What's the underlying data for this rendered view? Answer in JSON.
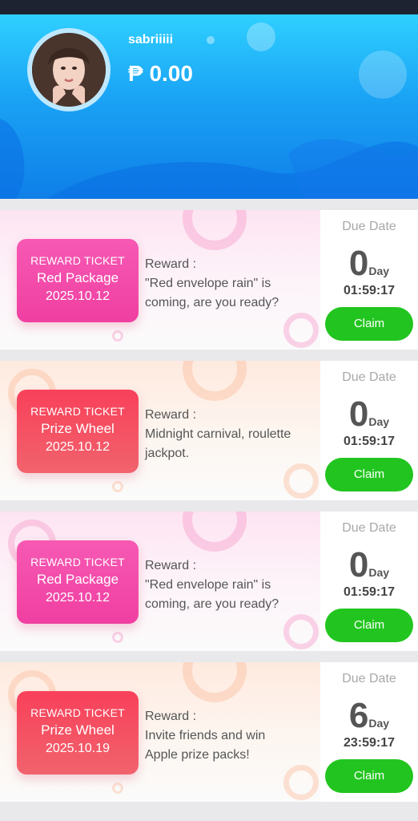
{
  "profile": {
    "username": "sabriiiii",
    "balance": "₱ 0.00"
  },
  "tickets": [
    {
      "type": "REWARD TICKET",
      "name": "Red Package",
      "date": "2025.10.12",
      "reward_label": "Reward :",
      "reward_text": "\"Red envelope rain\" is coming, are you ready?",
      "due_label": "Due Date",
      "days": "0",
      "days_unit": "Day",
      "time": "01:59:17",
      "claim_label": "Claim"
    },
    {
      "type": "REWARD TICKET",
      "name": "Prize Wheel",
      "date": "2025.10.12",
      "reward_label": "Reward :",
      "reward_text": "Midnight carnival, roulette jackpot.",
      "due_label": "Due Date",
      "days": "0",
      "days_unit": "Day",
      "time": "01:59:17",
      "claim_label": "Claim"
    },
    {
      "type": "REWARD TICKET",
      "name": "Red Package",
      "date": "2025.10.12",
      "reward_label": "Reward :",
      "reward_text": "\"Red envelope rain\" is coming, are you ready?",
      "due_label": "Due Date",
      "days": "0",
      "days_unit": "Day",
      "time": "01:59:17",
      "claim_label": "Claim"
    },
    {
      "type": "REWARD TICKET",
      "name": "Prize Wheel",
      "date": "2025.10.19",
      "reward_label": "Reward :",
      "reward_text": "Invite friends and win Apple prize packs!",
      "due_label": "Due Date",
      "days": "6",
      "days_unit": "Day",
      "time": "23:59:17",
      "claim_label": "Claim"
    }
  ],
  "colors": {
    "header": "#1aa3f5",
    "claim": "#22c51f",
    "pink_ticket": "#f03fa2",
    "red_ticket": "#f8405a"
  }
}
